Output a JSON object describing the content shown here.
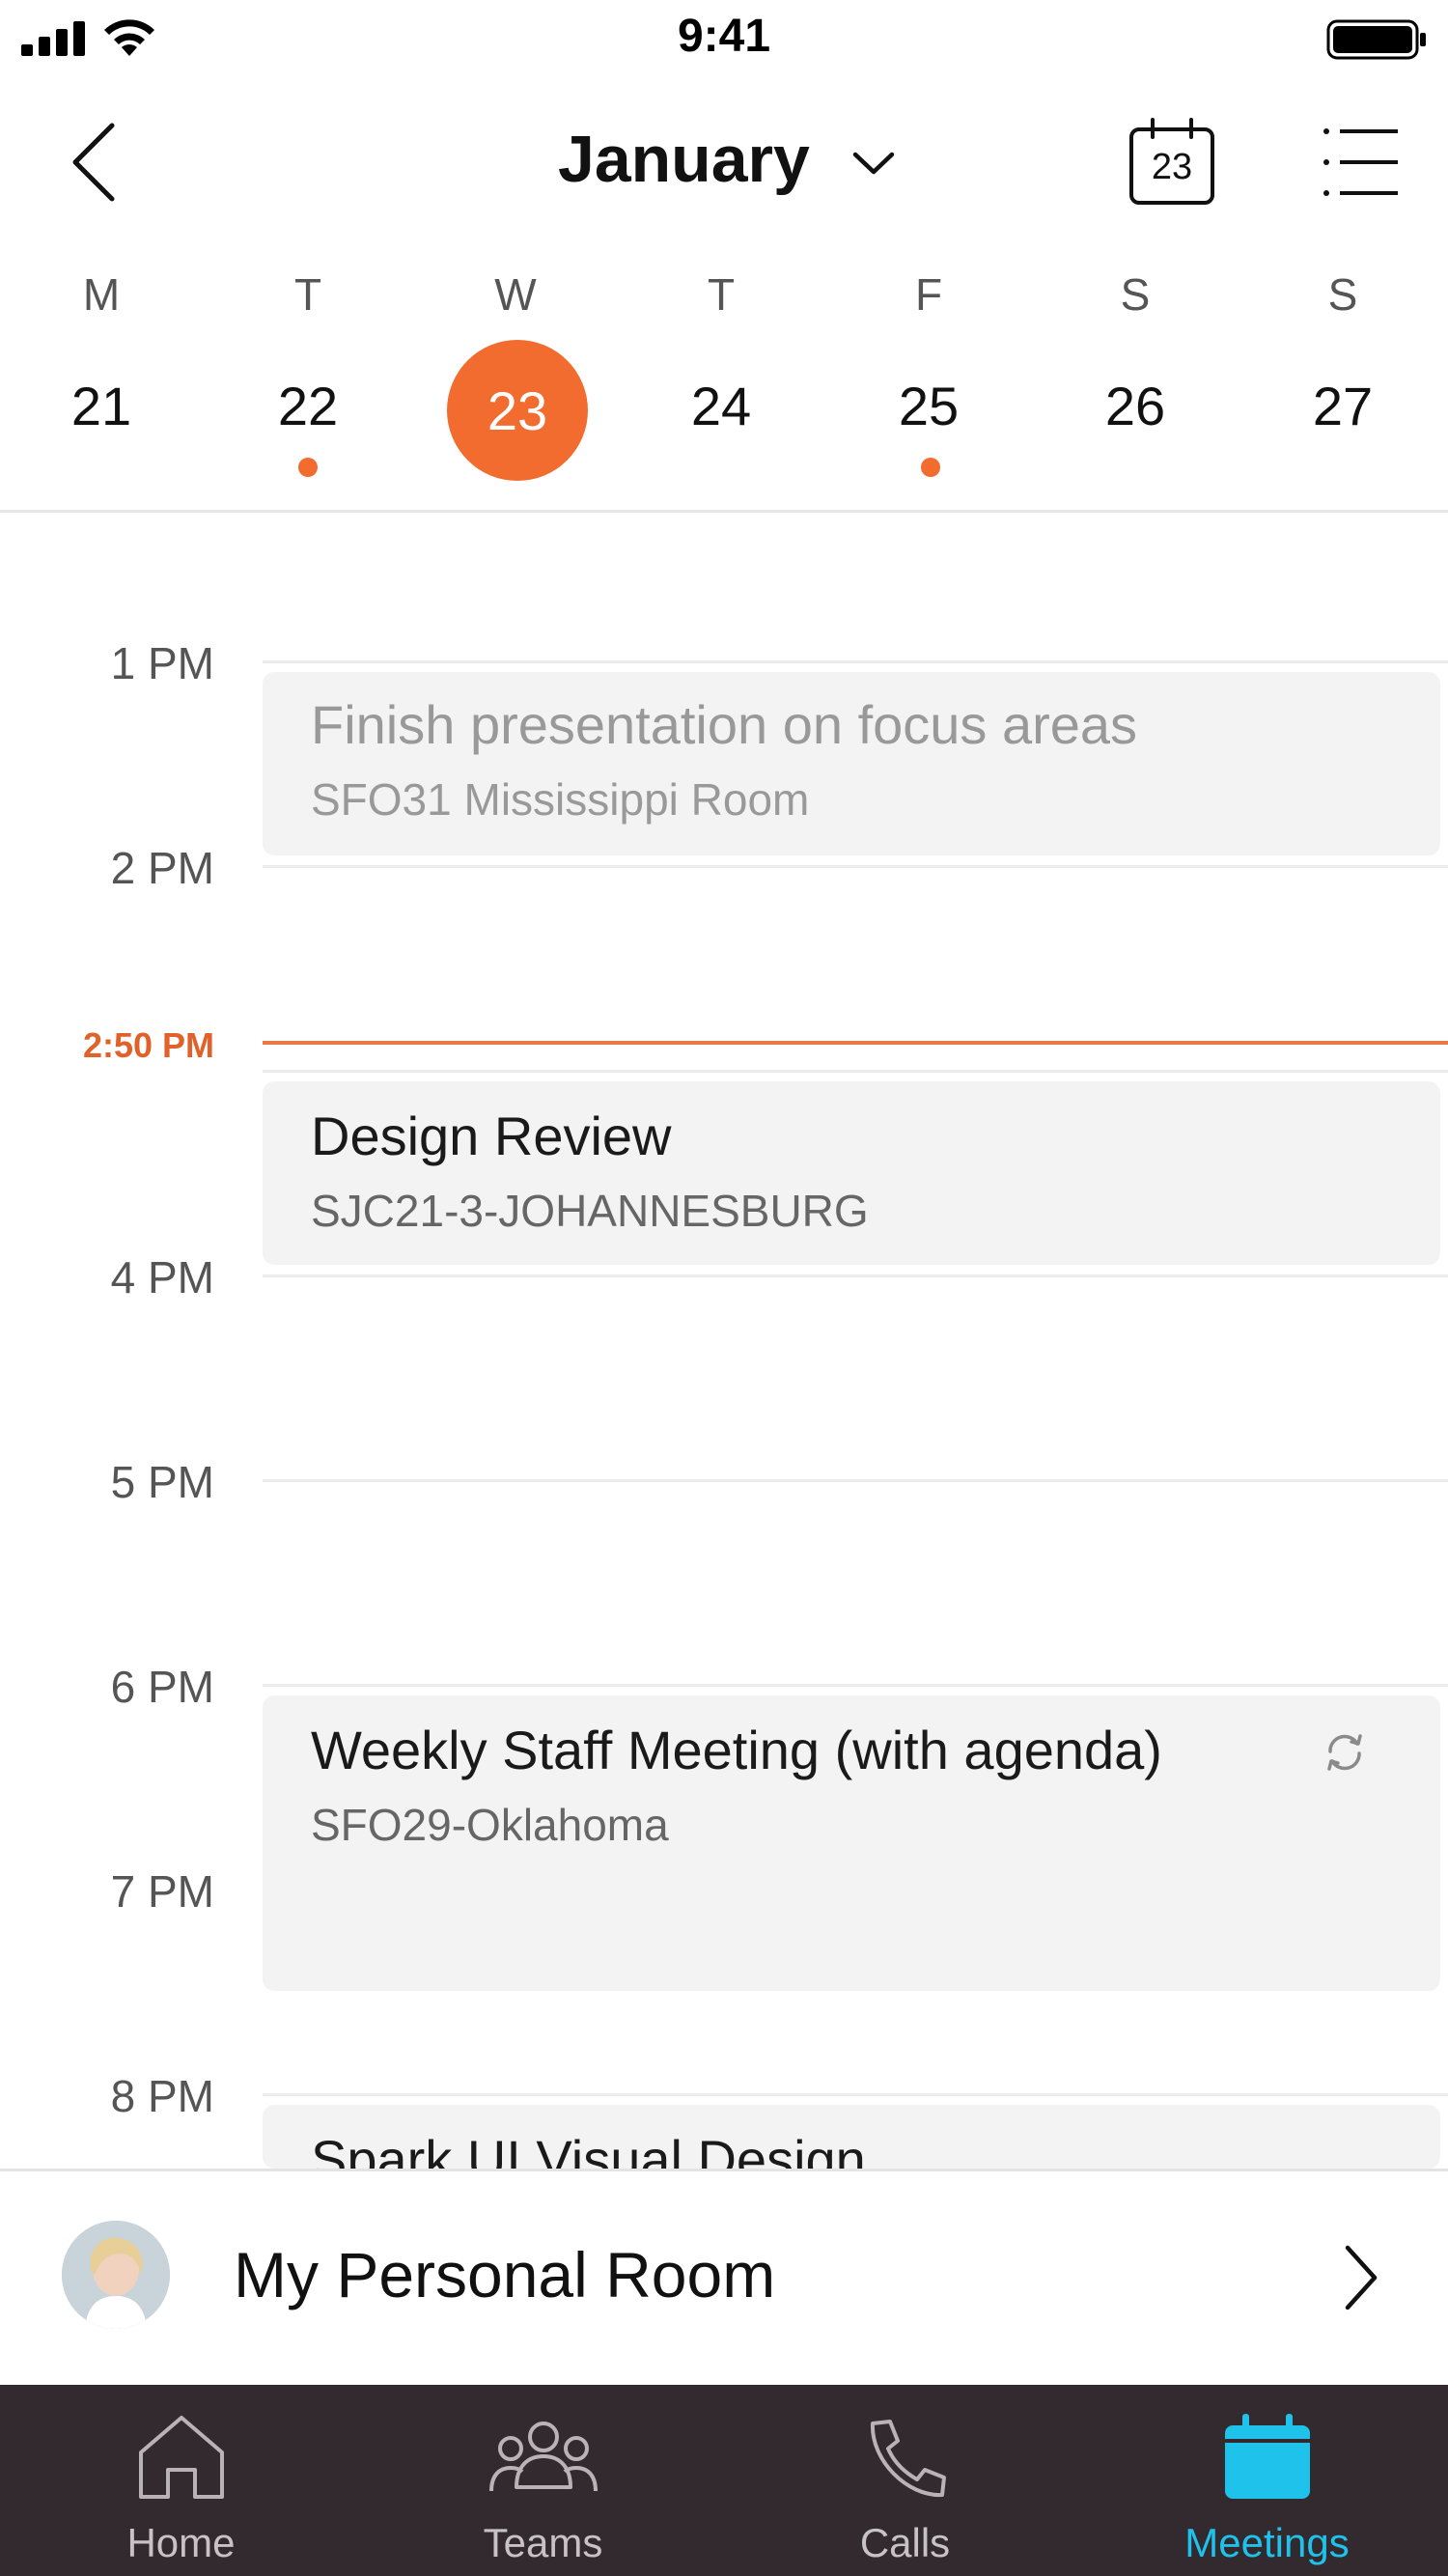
{
  "status_bar": {
    "time": "9:41"
  },
  "header": {
    "month": "January",
    "today_icon_day": "23"
  },
  "week": {
    "days": [
      {
        "dow": "M",
        "num": "21"
      },
      {
        "dow": "T",
        "num": "22"
      },
      {
        "dow": "W",
        "num": "23"
      },
      {
        "dow": "T",
        "num": "24"
      },
      {
        "dow": "F",
        "num": "25"
      },
      {
        "dow": "S",
        "num": "26"
      },
      {
        "dow": "S",
        "num": "27"
      }
    ],
    "selected_index": 2,
    "days_with_events": [
      1,
      4
    ]
  },
  "timeline": {
    "hours": [
      "1 PM",
      "2 PM",
      "4 PM",
      "5 PM",
      "6 PM",
      "7 PM",
      "8 PM"
    ],
    "current_time": "2:50 PM"
  },
  "events": [
    {
      "title": "Finish presentation on focus areas",
      "location": "SFO31 Mississippi Room"
    },
    {
      "title": "Design Review",
      "location": "SJC21-3-JOHANNESBURG"
    },
    {
      "title": "Weekly Staff Meeting (with agenda)",
      "location": "SFO29-Oklahoma"
    },
    {
      "title": "Spark UI Visual Design",
      "location": ""
    }
  ],
  "personal_room": {
    "label": "My Personal Room"
  },
  "tabs": [
    {
      "label": "Home"
    },
    {
      "label": "Teams"
    },
    {
      "label": "Calls"
    },
    {
      "label": "Meetings"
    }
  ],
  "colors": {
    "accent": "#f26b2f",
    "tab_active": "#1ec2ea",
    "tab_bar_bg": "#322a2f"
  }
}
